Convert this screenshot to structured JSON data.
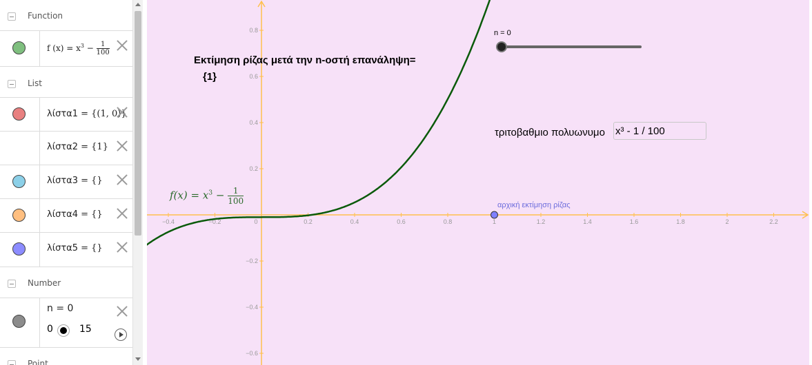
{
  "algebra": {
    "categories": {
      "function": "Function",
      "list": "List",
      "number": "Number",
      "point": "Point"
    },
    "function_row": {
      "color": "#7fbf7f",
      "def_prefix": "f (x) = x",
      "exp": "3",
      "minus": "−",
      "num": "1",
      "den": "100"
    },
    "lists": [
      {
        "label": "λίστα1",
        "value": "= {(1, 0)}",
        "color": "#e88080"
      },
      {
        "label": "λίστα2",
        "value": "= {1}",
        "color": ""
      },
      {
        "label": "λίστα3",
        "value": "= {}",
        "color": "#8cd0e8"
      },
      {
        "label": "λίστα4",
        "value": "= {}",
        "color": "#ffbf80"
      },
      {
        "label": "λίστα5",
        "value": "= {}",
        "color": "#8c8cff"
      }
    ],
    "number_row": {
      "label": "n = 0",
      "min": "0",
      "max": "15",
      "color": "#8c8c8c"
    }
  },
  "graphics": {
    "background": "#f7e1f8",
    "axis_color": "#ffc04d",
    "curve_color": "#0a5a0a",
    "heading_line1": "Εκτίμηση ρίζας μετά την n-οστή επανάληψη=",
    "heading_line2": "{1}",
    "slider_label": "n = 0",
    "slider_value": 0,
    "slider_range": [
      0,
      15
    ],
    "polynomial_label": "τριτοβαθμιο πολυωνυμο",
    "polynomial_input": "x³ - 1 / 100",
    "formula": {
      "lhs": "f(x)",
      "eq": "=",
      "x": "x",
      "exp": "3",
      "minus": "−",
      "num": "1",
      "den": "100"
    },
    "point_label": "αρχική εκτίμηση ρίζας",
    "point": {
      "x": 1,
      "y": 0,
      "color": "#7f7fff"
    },
    "x_ticks": [
      "−0.4",
      "−0.2",
      "0",
      "0.2",
      "0.4",
      "0.6",
      "0.8",
      "1",
      "1.2",
      "1.4",
      "1.6",
      "1.8",
      "2",
      "2.2"
    ],
    "y_ticks": [
      "0.8",
      "0.6",
      "0.4",
      "0.2",
      "−0.2",
      "−0.4",
      "−0.6"
    ]
  }
}
